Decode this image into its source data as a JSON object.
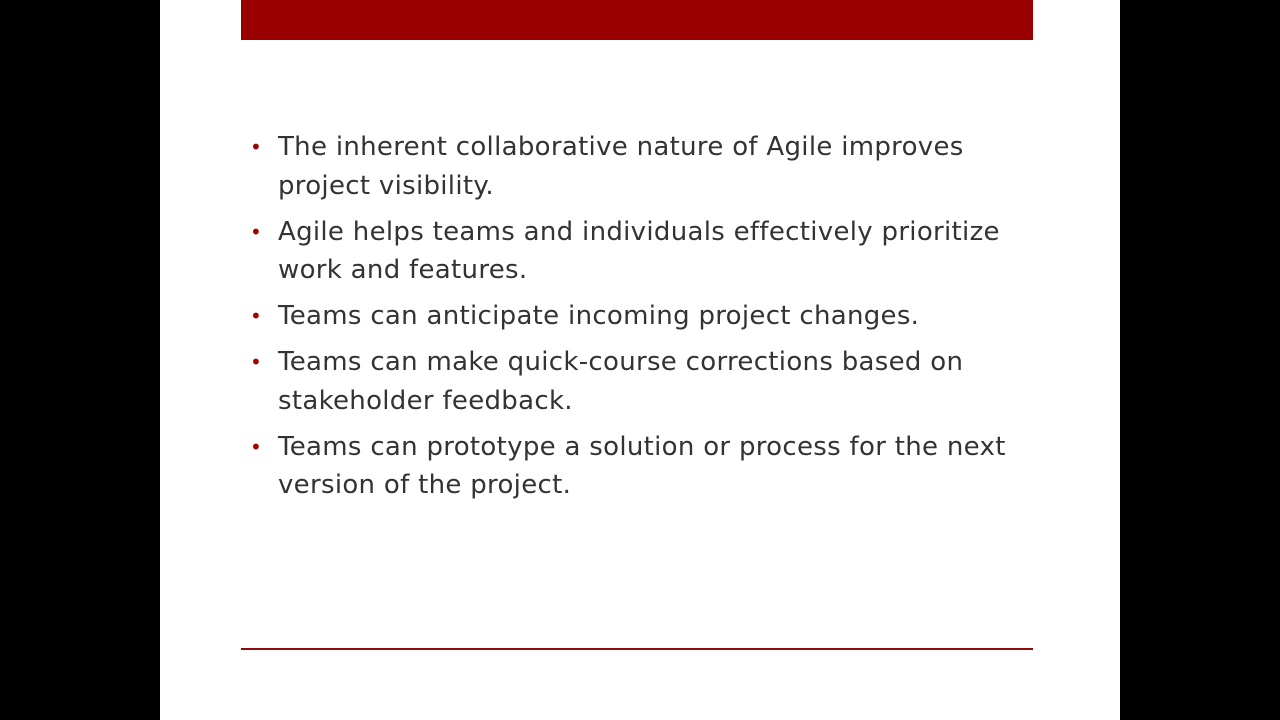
{
  "slide": {
    "accent_color": "#9b0000",
    "bullet_glyph": "•",
    "bullets": [
      "The inherent collaborative nature of Agile improves project visibility.",
      "Agile helps teams and individuals effectively prioritize work and features.",
      "Teams can anticipate incoming project changes.",
      "Teams can make quick-course corrections based on stakeholder feedback.",
      "Teams can prototype a solution or process for the next version of the project."
    ]
  }
}
